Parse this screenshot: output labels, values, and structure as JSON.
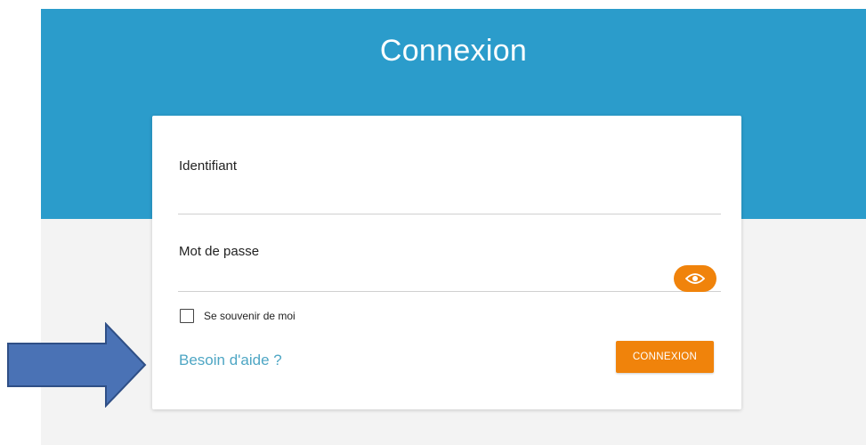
{
  "header": {
    "title": "Connexion"
  },
  "form": {
    "username_label": "Identifiant",
    "username_value": "",
    "password_label": "Mot de passe",
    "password_value": "",
    "show_password_icon": "eye-icon",
    "remember_label": "Se souvenir de moi",
    "remember_checked": false,
    "help_link": "Besoin d'aide ?",
    "submit_label": "CONNEXION"
  },
  "annotation": {
    "icon": "arrow-right-icon",
    "color": "#4a72b5"
  },
  "colors": {
    "header_bg": "#2b9ccb",
    "accent": "#f0830b",
    "link": "#4ea6c4",
    "page_bg": "#f3f3f3"
  }
}
